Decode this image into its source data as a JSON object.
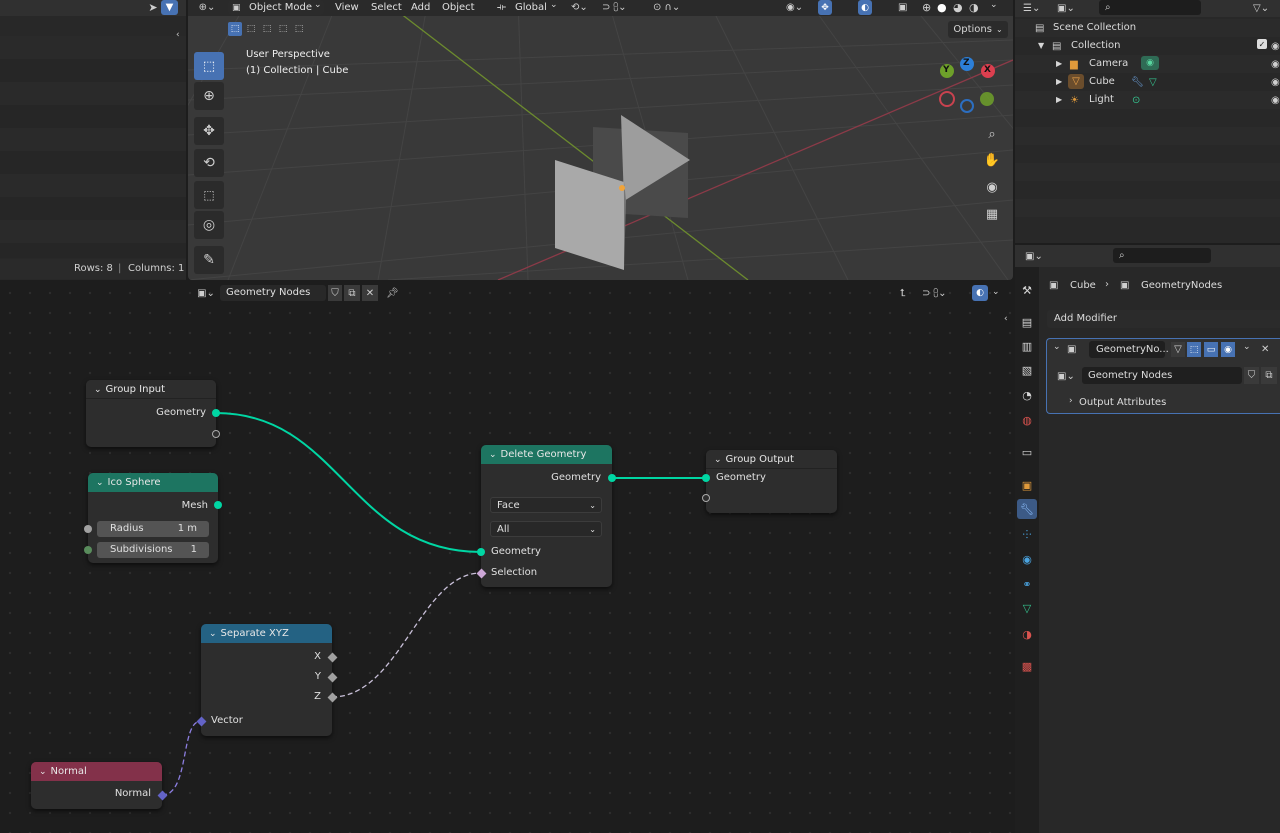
{
  "topbar": {
    "mode_label": "Object Mode",
    "menus": [
      "View",
      "Select",
      "Add",
      "Object"
    ],
    "transform_orientation": "Global"
  },
  "spreadsheet": {
    "status_rows": "Rows: 8",
    "status_cols": "Columns: 1"
  },
  "viewport": {
    "perspective_label": "User Perspective",
    "collection_label": "(1) Collection | Cube",
    "options_label": "Options",
    "gizmo_axes": {
      "x": "X",
      "y": "Y",
      "z": "Z"
    }
  },
  "outliner": {
    "items": [
      {
        "label": "Scene Collection",
        "icon": "scene-collection-icon"
      },
      {
        "label": "Collection",
        "icon": "collection-icon"
      },
      {
        "label": "Camera",
        "icon": "camera-object-icon"
      },
      {
        "label": "Cube",
        "icon": "mesh-object-icon"
      },
      {
        "label": "Light",
        "icon": "light-object-icon"
      }
    ]
  },
  "node_editor": {
    "tree_name": "Geometry Nodes"
  },
  "nodes": {
    "group_input": {
      "title": "Group Input",
      "output": "Geometry"
    },
    "ico_sphere": {
      "title": "Ico Sphere",
      "output": "Mesh",
      "radius_label": "Radius",
      "radius_value": "1 m",
      "subdiv_label": "Subdivisions",
      "subdiv_value": "1"
    },
    "delete_geometry": {
      "title": "Delete Geometry",
      "output": "Geometry",
      "domain": "Face",
      "mode": "All",
      "input_geometry": "Geometry",
      "input_selection": "Selection"
    },
    "group_output": {
      "title": "Group Output",
      "input": "Geometry"
    },
    "separate_xyz": {
      "title": "Separate XYZ",
      "out_x": "X",
      "out_y": "Y",
      "out_z": "Z",
      "input": "Vector"
    },
    "normal": {
      "title": "Normal",
      "output": "Normal"
    }
  },
  "properties": {
    "breadcrumb_object": "Cube",
    "breadcrumb_modifier": "GeometryNodes",
    "add_modifier": "Add Modifier",
    "modifier_name": "GeometryNo...",
    "node_group": "Geometry Nodes",
    "output_attributes": "Output Attributes"
  },
  "colors": {
    "geometry_socket": "#00d6a3",
    "geometry_header": "#1d7561",
    "converter_header": "#246283",
    "input_header": "#83314a",
    "float_socket": "#a1a1a1",
    "int_socket": "#598c5c",
    "bool_socket": "#cca6d6",
    "vector_socket": "#6363c7",
    "accent": "#4772b3"
  }
}
